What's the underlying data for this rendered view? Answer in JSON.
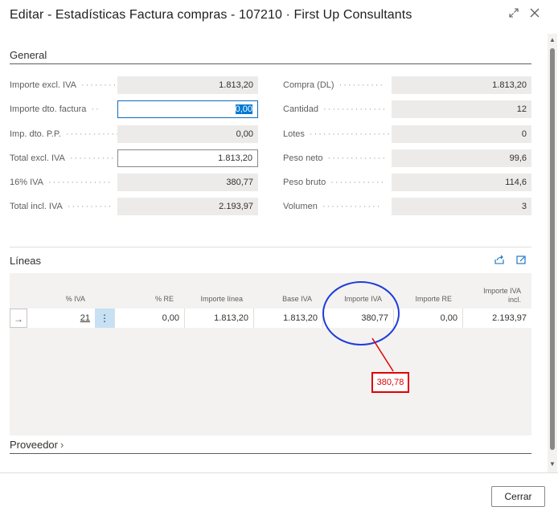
{
  "window": {
    "title": "Editar - Estadísticas Factura compras - 107210 · First Up Consultants",
    "expand_icon": "expand-icon",
    "close_icon": "close-icon"
  },
  "general": {
    "title": "General",
    "left_fields": [
      {
        "label": "Importe excl. IVA",
        "value": "1.813,20"
      },
      {
        "label": "Importe dto. factura",
        "value": "0,00"
      },
      {
        "label": "Imp. dto. P.P.",
        "value": "0,00"
      },
      {
        "label": "Total excl. IVA",
        "value": "1.813,20"
      },
      {
        "label": "16% IVA",
        "value": "380,77"
      },
      {
        "label": "Total incl. IVA",
        "value": "2.193,97"
      }
    ],
    "right_fields": [
      {
        "label": "Compra (DL)",
        "value": "1.813,20"
      },
      {
        "label": "Cantidad",
        "value": "12"
      },
      {
        "label": "Lotes",
        "value": "0"
      },
      {
        "label": "Peso neto",
        "value": "99,6"
      },
      {
        "label": "Peso bruto",
        "value": "114,6"
      },
      {
        "label": "Volumen",
        "value": "3"
      }
    ]
  },
  "lines": {
    "title": "Líneas",
    "share_icon": "share-icon",
    "open_icon": "open-in-new-icon",
    "columns": [
      "% IVA",
      "% RE",
      "Importe línea",
      "Base IVA",
      "Importe IVA",
      "Importe RE",
      "Importe IVA incl."
    ],
    "row": {
      "iva_pct": "21",
      "re_pct": "0,00",
      "importe_linea": "1.813,20",
      "base_iva": "1.813,20",
      "importe_iva": "380,77",
      "importe_re": "0,00",
      "importe_iva_incl": "2.193,97"
    }
  },
  "annotation": {
    "callout_value": "380,78",
    "color": "#e00000",
    "circle_color": "#1f3ed8"
  },
  "proveedor": {
    "title": "Proveedor"
  },
  "footer": {
    "close_label": "Cerrar"
  },
  "colors": {
    "accent": "#0f6cbd",
    "field_bg": "#edebe9",
    "grid_bg": "#f3f2f1",
    "selected_cell": "#c7e0f4"
  }
}
